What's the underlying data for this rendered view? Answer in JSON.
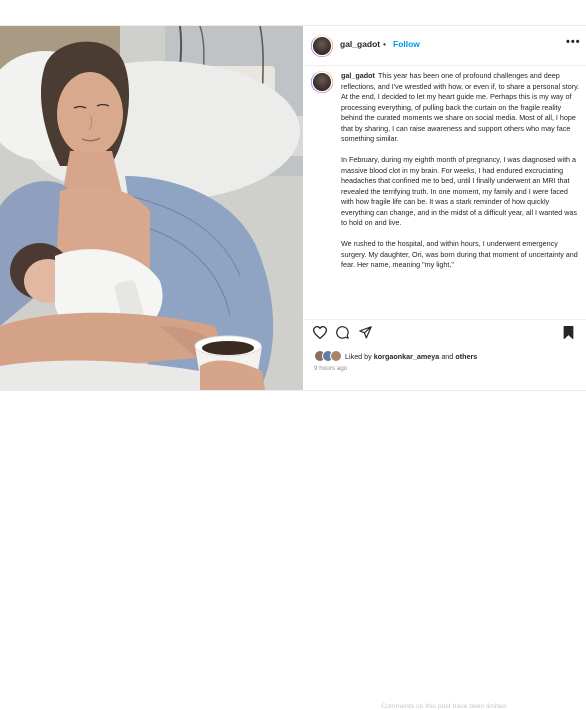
{
  "post": {
    "username": "gal_gadot",
    "separator": "•",
    "follow_label": "Follow",
    "more_label": "•••",
    "caption_paragraphs": [
      "This year has been one of profound challenges and deep reflections, and I've wrestled with how, or even if, to share a personal story. At the end, I decided to let my heart guide me. Perhaps this is my way of processing everything, of pulling back the curtain on the fragile reality behind the curated moments we share on social media. Most of all, I hope that by sharing, I can raise awareness and support others who may face something similar.",
      "In February, during my eighth month of pregnancy, I was diagnosed with a massive blood clot in my brain. For weeks, I had endured excruciating headaches that confined me to bed, until I finally underwent an MRI that revealed the terrifying truth. In one moment, my family and I were faced with how fragile life can be. It was a stark reminder of how quickly everything can change, and in the midst of a difficult year, all I wanted was to hold on and live.",
      "We rushed to the hospital, and within hours, I underwent emergency surgery. My daughter, Ori, was born during that moment of uncertainty and fear. Her name, meaning \"my light,\""
    ],
    "liked_by_prefix": "Liked by",
    "liked_by_user": "korgaonkar_ameya",
    "liked_by_and": "and",
    "liked_by_others": "others",
    "time_ago": "9 hours ago",
    "comments_disabled": "Comments on this post have been limited."
  },
  "icons": {
    "like": "heart-icon",
    "comment": "comment-icon",
    "share": "share-icon",
    "save": "bookmark-icon"
  },
  "colors": {
    "follow_blue": "#0095f6",
    "text": "#262626",
    "muted": "#8e8e8e"
  }
}
